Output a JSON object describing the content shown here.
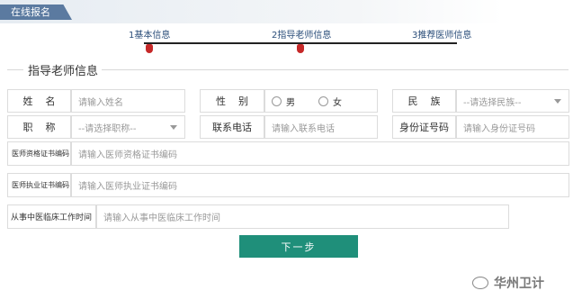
{
  "header": {
    "tab_label": "在线报名"
  },
  "steps": [
    {
      "label": "1基本信息"
    },
    {
      "label": "2指导老师信息"
    },
    {
      "label": "3推荐医师信息"
    }
  ],
  "section": {
    "title": "指导老师信息"
  },
  "form": {
    "name": {
      "label": "姓名",
      "placeholder": "请输入姓名"
    },
    "gender": {
      "label": "性别",
      "options": [
        "男",
        "女"
      ]
    },
    "ethnicity": {
      "label": "民族",
      "placeholder": "--请选择民族--"
    },
    "title": {
      "label": "职称",
      "placeholder": "--请选择职称--"
    },
    "phone": {
      "label": "联系电话",
      "placeholder": "请输入联系电话"
    },
    "id_number": {
      "label": "身份证号码",
      "placeholder": "请输入身份证号码"
    },
    "qualification_cert": {
      "label": "医师资格证书编码",
      "placeholder": "请输入医师资格证书编码"
    },
    "practice_cert": {
      "label": "医师执业证书编码",
      "placeholder": "请输入医师执业证书编码"
    },
    "work_time": {
      "label": "从事中医临床工作时间",
      "placeholder": "请输入从事中医临床工作时间"
    }
  },
  "next_button": {
    "label": "下一步"
  },
  "watermark": {
    "text": "华州卫计",
    "icon": "wechat-icon"
  }
}
